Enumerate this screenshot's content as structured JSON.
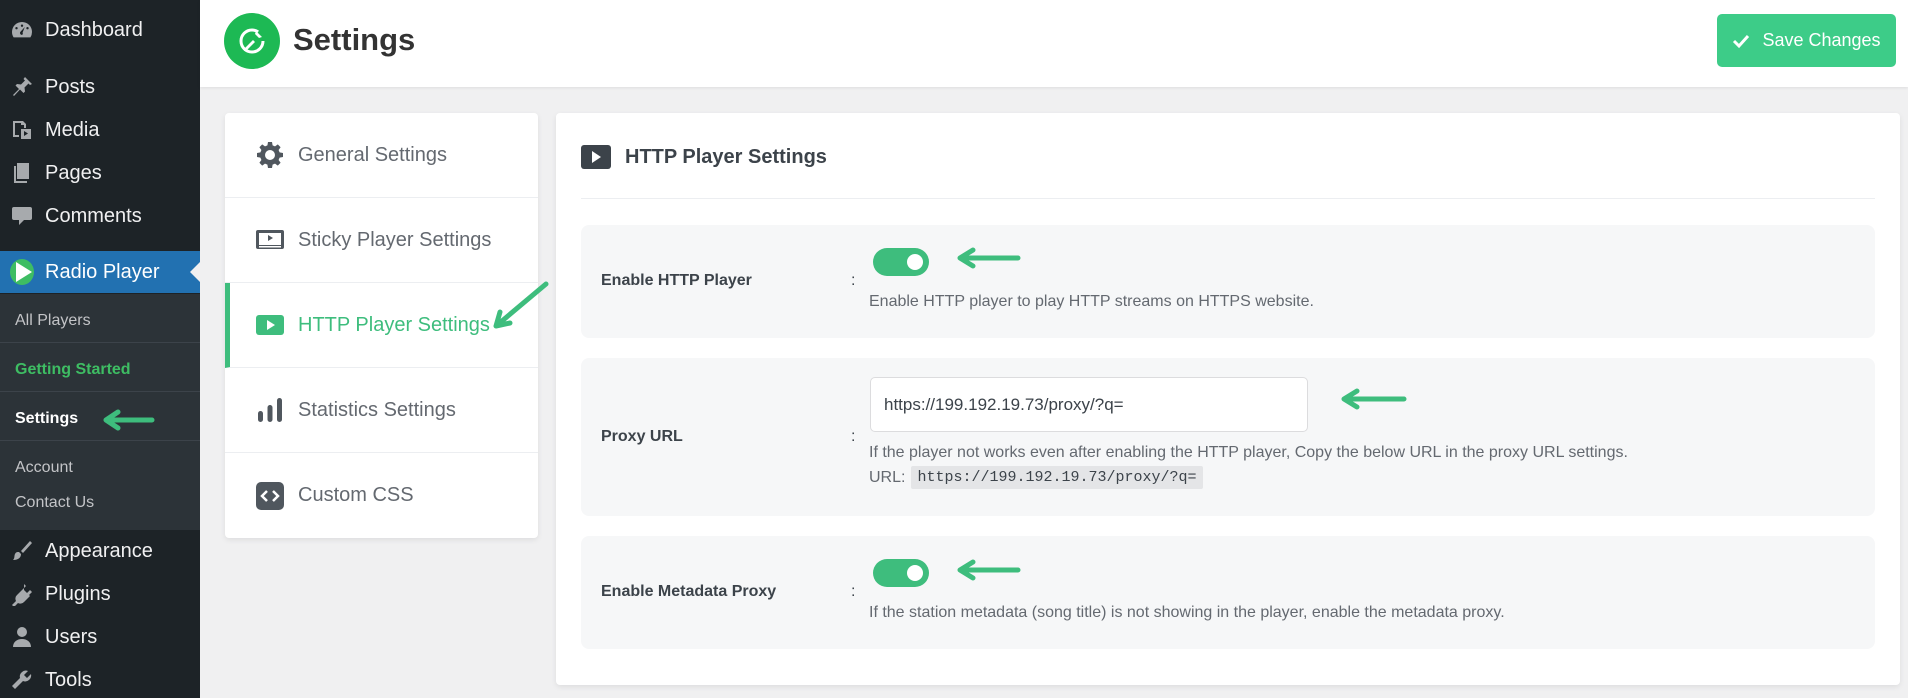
{
  "wp_menu": {
    "dashboard": "Dashboard",
    "posts": "Posts",
    "media": "Media",
    "pages": "Pages",
    "comments": "Comments",
    "radio_player": "Radio Player",
    "submenu": {
      "all_players": "All Players",
      "getting_started": "Getting Started",
      "settings": "Settings",
      "account": "Account",
      "contact_us": "Contact Us"
    },
    "appearance": "Appearance",
    "plugins": "Plugins",
    "users": "Users",
    "tools": "Tools"
  },
  "header": {
    "title": "Settings",
    "save_label": "Save Changes"
  },
  "settings_nav": {
    "items": [
      {
        "label": "General Settings",
        "icon": "gear-icon"
      },
      {
        "label": "Sticky Player Settings",
        "icon": "monitor-icon"
      },
      {
        "label": "HTTP Player Settings",
        "icon": "play-icon",
        "active": true
      },
      {
        "label": "Statistics Settings",
        "icon": "bar-chart-icon"
      },
      {
        "label": "Custom CSS",
        "icon": "code-icon"
      }
    ]
  },
  "section": {
    "title": "HTTP Player Settings",
    "fields": {
      "http_player": {
        "label": "Enable HTTP Player",
        "colon": ":",
        "enabled": true,
        "description": "Enable HTTP player to play HTTP streams on HTTPS website."
      },
      "proxy_url": {
        "label": "Proxy URL",
        "colon": ":",
        "value": "https://199.192.19.73/proxy/?q=",
        "description": "If the player not works even after enabling the HTTP player, Copy the below URL in the proxy URL settings.",
        "url_prefix": "URL:",
        "url_code": "https://199.192.19.73/proxy/?q="
      },
      "metadata_proxy": {
        "label": "Enable Metadata Proxy",
        "colon": ":",
        "enabled": true,
        "description": "If the station metadata (song title) is not showing in the player, enable the metadata proxy."
      }
    }
  },
  "colors": {
    "accent": "#3ebd7d",
    "wp_sidebar": "#1d2327",
    "wp_highlight": "#2271b1",
    "save_button": "#3dcc88"
  }
}
